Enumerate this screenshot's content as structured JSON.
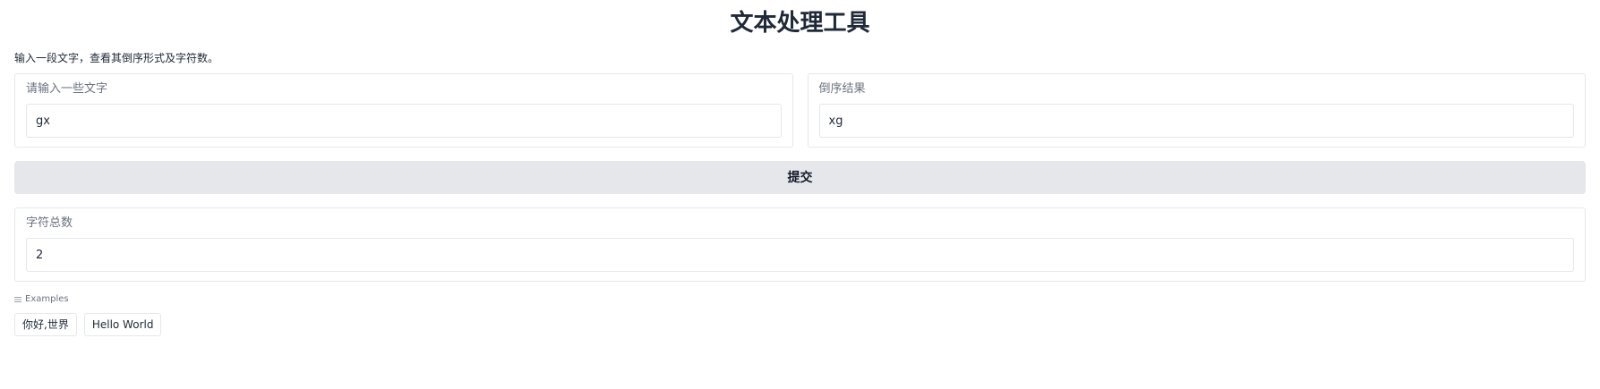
{
  "app": {
    "title": "文本处理工具",
    "description": "输入一段文字，查看其倒序形式及字符数。"
  },
  "input": {
    "label": "请输入一些文字",
    "value": "gx"
  },
  "reversed": {
    "label": "倒序结果",
    "value": "xg"
  },
  "submit": {
    "label": "提交"
  },
  "count": {
    "label": "字符总数",
    "value": "2"
  },
  "examples": {
    "label": "Examples",
    "icon": "list-icon",
    "items": [
      "你好,世界",
      "Hello World"
    ]
  },
  "colors": {
    "border": "#e5e7eb",
    "button_bg": "#e5e7eb",
    "label": "#6b7280"
  }
}
